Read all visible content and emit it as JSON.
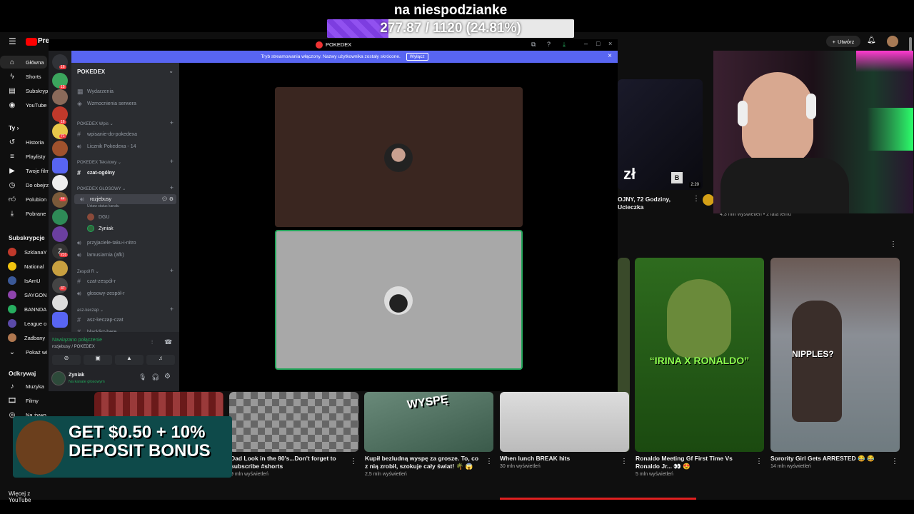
{
  "overlay": {
    "title": "na niespodzianke",
    "progress_text": "277.87 / 1120 (24.81%)",
    "progress_fraction": 0.2481,
    "accent": "#7d3de0"
  },
  "youtube": {
    "logo": "Pre",
    "create_label": "Utwórz",
    "sidebar": {
      "items": [
        {
          "label": "Główna",
          "icon": "home-icon"
        },
        {
          "label": "Shorts",
          "icon": "shorts-icon"
        },
        {
          "label": "Subskryp",
          "icon": "subscriptions-icon"
        },
        {
          "label": "YouTube",
          "icon": "youtube-music-icon"
        }
      ],
      "you_head": "Ty",
      "you_items": [
        {
          "label": "Historia",
          "icon": "history-icon"
        },
        {
          "label": "Playlisty",
          "icon": "playlist-icon"
        },
        {
          "label": "Twoje film",
          "icon": "your-videos-icon"
        },
        {
          "label": "Do obejrz",
          "icon": "watch-later-icon"
        },
        {
          "label": "Polubion",
          "icon": "like-icon"
        },
        {
          "label": "Pobrane",
          "icon": "download-icon"
        }
      ],
      "subs_head": "Subskrypcje",
      "subs": [
        "SzklanaY",
        "National",
        "IsAmU",
        "SAYGON",
        "BANNDA",
        "League o",
        "Zadbany"
      ],
      "show_more": "Pokaż wi",
      "explore_head": "Odkrywaj",
      "explore_items": [
        {
          "label": "Muzyka",
          "icon": "music-icon"
        },
        {
          "label": "Filmy",
          "icon": "movies-icon"
        },
        {
          "label": "Na żywo",
          "icon": "live-icon"
        }
      ],
      "more_from": "Więcej z YouTube"
    },
    "top_video": {
      "title": "OJNY, 72 Godziny, Ucieczka",
      "duration": "2:20",
      "meta": "4,3 mln wyświetleń • 2 lata temu",
      "thumb_text": "zł"
    },
    "shorts": [
      {
        "title": "Dad Look in the 80's...Don't forget to subscribe #shorts",
        "meta": "9 mln wyświetleń",
        "thumb_text": ""
      },
      {
        "title": "Kupił bezludną wyspę za grosze. To, co z nią zrobił, szokuje cały świat! 🌴 😱",
        "meta": "2,5 mln wyświetleń",
        "thumb_text": "WYSPĘ"
      },
      {
        "title": "When lunch BREAK hits",
        "meta": "30 mln wyświetleń",
        "thumb_text": ""
      },
      {
        "title": "Ronaldo Meeting Gf First Time Vs Ronaldo Jr... 👀 😍",
        "meta": "5 mln wyświetleń",
        "thumb_text": "“IRINA X RONALDO”"
      },
      {
        "title": "Sorority Girl Gets ARRESTED 😂 😂",
        "meta": "14 mln wyświetleń",
        "thumb_text": "NIPPLES?"
      }
    ]
  },
  "discord": {
    "window_title": "POKEDEX",
    "banner_text": "Tryb streamowania włączony. Nazwy użytkownika zostały skrócone.",
    "banner_button": "Wyłącz",
    "server_name": "POKEDEX",
    "top_items": [
      "Wydarzenia",
      "Wzmocnienia serwera"
    ],
    "categories": [
      {
        "name": "POKEDEX Wpis",
        "channels": [
          "wpisanie-do-pokedexa",
          "Licznik Pokedexa - 14"
        ]
      },
      {
        "name": "POKEDEX Tekstowy",
        "channels": [
          "czat-ogólny"
        ]
      },
      {
        "name": "POKEDEX GŁOSOWY",
        "channels": [
          "rozjebusy"
        ]
      },
      {
        "name": "Zespół R",
        "channels": [
          "czat-zespół-r",
          "głosowy-zespół-r"
        ]
      },
      {
        "name": "asz-keczap",
        "channels": [
          "asz-keczap-czat",
          "blacklist-here"
        ]
      }
    ],
    "voice_status": "Ustaw status kanału",
    "voice_users": [
      "DGU",
      "Zyniak"
    ],
    "other_voice": [
      "przyjaciele-taku-i-nitro",
      "lamusiarnia (afk)"
    ],
    "connection": {
      "status": "Nawiązano połączenie",
      "where": "rozjebusy / POKEDEX"
    },
    "user": {
      "name": "Zyniak",
      "status": "Na kanale głosowym"
    },
    "badges": [
      "16",
      "15",
      "16",
      "71",
      "44",
      "231",
      "37"
    ]
  },
  "promo": {
    "line1": "GET $0.50 + 10%",
    "line2": "DEPOSIT BONUS"
  }
}
